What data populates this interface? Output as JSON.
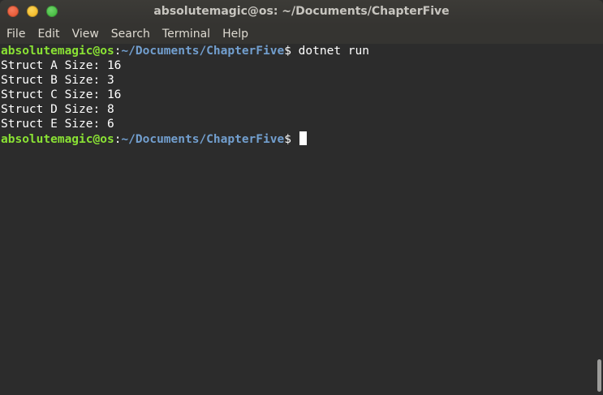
{
  "window": {
    "title": "absolutemagic@os: ~/Documents/ChapterFive"
  },
  "menu": {
    "items": [
      "File",
      "Edit",
      "View",
      "Search",
      "Terminal",
      "Help"
    ]
  },
  "terminal": {
    "prompt_user": "absolutemagic@os",
    "prompt_sep": ":",
    "prompt_path": "~/Documents/ChapterFive",
    "prompt_symbol": "$",
    "command": " dotnet run",
    "output": [
      "Struct A Size: 16",
      "Struct B Size: 3",
      "Struct C Size: 16",
      "Struct D Size: 8",
      "Struct E Size: 6"
    ]
  },
  "colors": {
    "prompt_user": "#8ae234",
    "prompt_path": "#729fcf",
    "background": "#2c2c2c",
    "text": "#ffffff"
  }
}
